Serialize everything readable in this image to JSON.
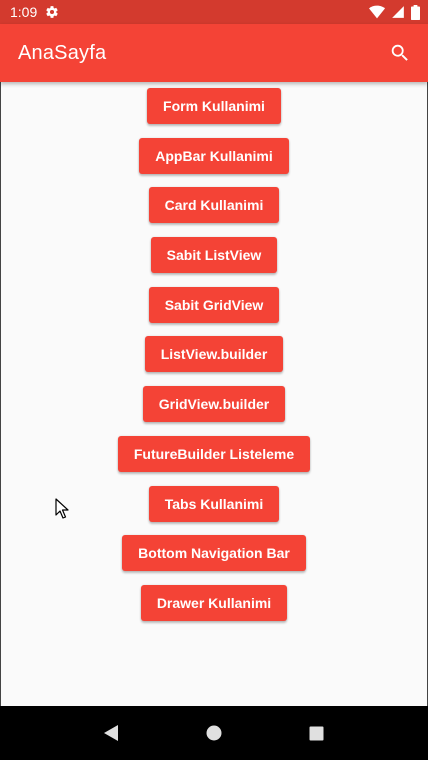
{
  "status_bar": {
    "time": "1:09",
    "background": "#d33a2e"
  },
  "app_bar": {
    "title": "AnaSayfa",
    "background": "#f44336",
    "action_icon": "search-icon"
  },
  "buttons": [
    {
      "label": "Form Kullanimi"
    },
    {
      "label": "AppBar Kullanimi"
    },
    {
      "label": "Card Kullanimi"
    },
    {
      "label": "Sabit ListView"
    },
    {
      "label": "Sabit GridView"
    },
    {
      "label": "ListView.builder"
    },
    {
      "label": "GridView.builder"
    },
    {
      "label": "FutureBuilder Listeleme"
    },
    {
      "label": "Tabs Kullanimi"
    },
    {
      "label": "Bottom Navigation Bar"
    },
    {
      "label": "Drawer Kullanimi"
    }
  ],
  "button_color": "#f44336",
  "nav_bar": {
    "icons": [
      "back-icon",
      "home-icon",
      "recents-icon"
    ]
  }
}
